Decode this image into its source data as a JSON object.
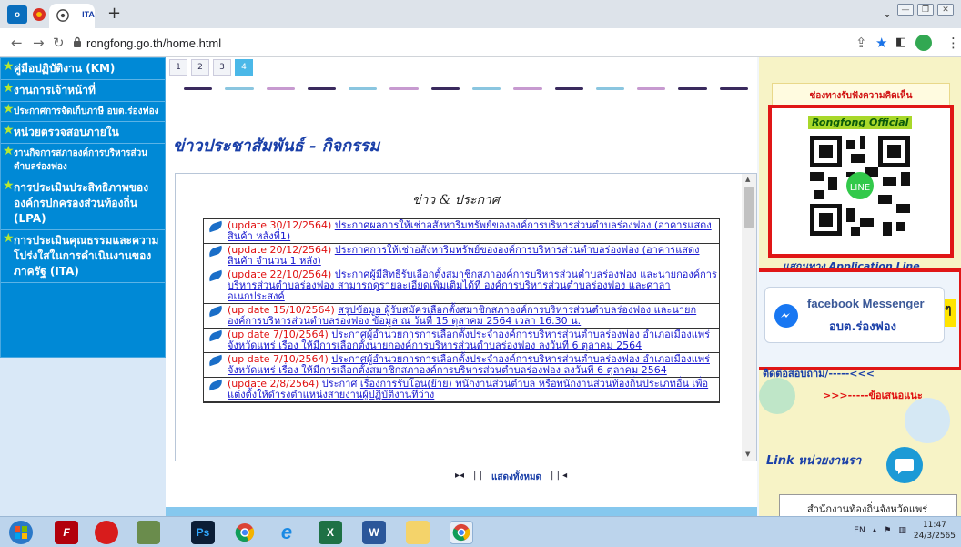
{
  "browser": {
    "url": "rongfong.go.th/home.html",
    "tabs": [
      {
        "icon": "outlook-icon"
      },
      {
        "icon": "record-icon"
      },
      {
        "icon": "chrome-icon",
        "active": true
      },
      {
        "icon": "ita-icon",
        "label": "ITA"
      }
    ],
    "new_tab": "+"
  },
  "left_nav": {
    "items": [
      {
        "label": "คู่มือปฏิบัติงาน (KM)"
      },
      {
        "label": "งานการเจ้าหน้าที่"
      },
      {
        "label": "ประกาศการจัดเก็บภาษี อบต.ร่องฟอง",
        "small": true
      },
      {
        "label": "หน่วยตรวจสอบภายใน"
      },
      {
        "label": "งานกิจการสภาองค์การบริหารส่วนตำบลร่องฟอง",
        "small": true
      },
      {
        "label": "การประเมินประสิทธิภาพขององค์กรปกครองส่วนท้องถิ่น (LPA)"
      },
      {
        "label": "การประเมินคุณธรรมและความโปร่งใสในการดำเนินงานของภาครัฐ (ITA)"
      }
    ]
  },
  "pager": {
    "pages": [
      "1",
      "2",
      "3",
      "4"
    ],
    "active": "4"
  },
  "news": {
    "section_title": "ข่าวประชาสัมพันธ์ - กิจกรรม",
    "panel_title": "ข่าว & ประกาศ",
    "show_all": "แสดงทั้งหมด",
    "items": [
      {
        "date": "(update 30/12/2564)",
        "text": "ประกาศผลการให้เช่าอสังหาริมทรัพย์ขององค์การบริหารส่วนตำบลร่องฟอง (อาคารแสดงสินค้า หลังที่1)"
      },
      {
        "date": "(update 20/12/2564)",
        "text": "ประกาศการให้เช่าอสังหาริมทรัพย์ขององค์การบริหารส่วนตำบลร่องฟอง (อาคารแสดงสินค้า จำนวน 1 หลัง)"
      },
      {
        "date": "(update 22/10/2564)",
        "text": "ประกาศผู้มีสิทธิรับเลือกตั้งสมาชิกสภาองค์การบริหารส่วนตำบลร่องฟอง และนายกองค์การบริหารส่วนตำบลร่องฟอง สามารถดูรายละเอียดเพิ่มเติมได้ที่ องค์การบริหารส่วนตำบลร่องฟอง และศาลาอเนกประสงค์"
      },
      {
        "date": "(up date 15/10/2564)",
        "text": "สรุปข้อมูล ผู้รับสมัครเลือกตั้งสมาชิกสภาองค์การบริหารส่วนตำบลร่องฟอง และนายกองค์การบริหารส่วนตำบลร่องฟอง ข้อมูล ณ วันที่ 15 ตุลาคม 2564 เวลา 16.30 น."
      },
      {
        "date": "(up date 7/10/2564)",
        "text": "ประกาศผู้อำนวยการการเลือกตั้งประจำองค์การบริหารส่วนตำบลร่องฟอง อำเภอเมืองแพร่ จังหวัดแพร่ เรื่อง ให้มีการเลือกตั้งนายกองค์การบริหารส่วนตำบลร่องฟอง ลงวันที่ 6 ตุลาคม 2564"
      },
      {
        "date": "(up date 7/10/2564)",
        "text": "ประกาศผู้อำนวยการการเลือกตั้งประจำองค์การบริหารส่วนตำบลร่องฟอง อำเภอเมืองแพร่ จังหวัดแพร่ เรื่อง ให้มีการเลือกตั้งสมาชิกสภาองค์การบริหารส่วนตำบลร่องฟอง ลงวันที่ 6 ตุลาคม 2564"
      },
      {
        "date": "(update 2/8/2564)",
        "prefix": " ประกาศ ",
        "text": "เรื่องการรับโอน(ย้าย) พนักงานส่วนตำบล หรือพนักงานส่วนท้องถิ่นประเภทอื่น เพื่อแต่งตั้งให้ดำรงตำแหน่งสายงานผู้ปฏิบัติงานที่ว่าง"
      }
    ]
  },
  "right": {
    "heading": "ช่องทางรับฟังความคิดเห็น",
    "qr_title": "Rongfong Official",
    "line_caption": "แสกนทาง Application Line",
    "fb_brand": "facebook Messenger",
    "fb_name": "อบต.ร่องฟอง",
    "contact": "ติดต่อสอบถาม/-----<<<",
    "suggest": ">>>-----ข้อเสนอแนะ",
    "link_units": "Link หน่วยงานรา",
    "local_office": "สำนักงานท้องถิ่นจังหวัดแพร่",
    "edge_char": "ๆ"
  },
  "taskbar": {
    "apps": [
      {
        "icon": "start-orb-icon"
      },
      {
        "icon": "filezilla-icon",
        "text": "F"
      },
      {
        "icon": "recorder-icon"
      },
      {
        "icon": "game-icon"
      },
      {
        "icon": "photoshop-icon",
        "text": "Ps"
      },
      {
        "icon": "chrome-icon"
      },
      {
        "icon": "internet-explorer-icon",
        "text": "e"
      },
      {
        "icon": "excel-icon",
        "text": "X"
      },
      {
        "icon": "word-icon",
        "text": "W"
      },
      {
        "icon": "file-explorer-icon"
      },
      {
        "icon": "chrome-icon"
      }
    ],
    "lang": "EN",
    "time": "11:47",
    "date": "24/3/2565"
  },
  "colors": {
    "nav_blue": "#0089d6",
    "accent_red": "#e01616",
    "link_blue": "#1a1ad0",
    "date_red": "#e01010"
  }
}
